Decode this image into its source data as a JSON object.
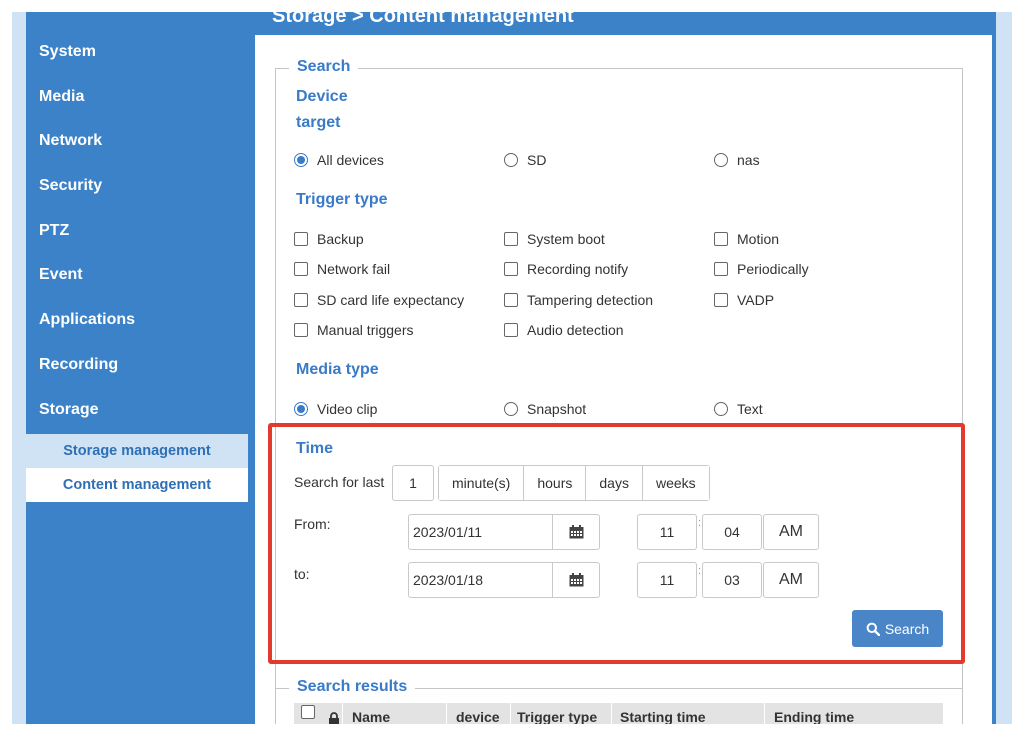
{
  "breadcrumb": "Storage  > Content management",
  "sidebar": {
    "items": [
      {
        "label": "System"
      },
      {
        "label": "Media"
      },
      {
        "label": "Network"
      },
      {
        "label": "Security"
      },
      {
        "label": "PTZ"
      },
      {
        "label": "Event"
      },
      {
        "label": "Applications"
      },
      {
        "label": "Recording"
      },
      {
        "label": "Storage"
      }
    ],
    "subitems": [
      {
        "label": "Storage management",
        "active": false
      },
      {
        "label": "Content management",
        "active": true
      }
    ]
  },
  "search": {
    "legend": "Search",
    "device_target": {
      "title_line1": "Device",
      "title_line2": "target",
      "options": [
        "All devices",
        "SD",
        "nas"
      ],
      "selected": "All devices"
    },
    "trigger_type": {
      "title": "Trigger type",
      "options": [
        "Backup",
        "System boot",
        "Motion",
        "Network fail",
        "Recording notify",
        "Periodically",
        "SD card life expectancy",
        "Tampering detection",
        "VADP",
        "Manual triggers",
        "Audio detection"
      ]
    },
    "media_type": {
      "title": "Media type",
      "options": [
        "Video clip",
        "Snapshot",
        "Text"
      ],
      "selected": "Video clip"
    }
  },
  "time": {
    "title": "Time",
    "search_for_last_label": "Search for last",
    "last_value": "1",
    "units": [
      "minute(s)",
      "hours",
      "days",
      "weeks"
    ],
    "from_label": "From:",
    "from_date": "2023/01/11",
    "from_hour": "11",
    "from_minute": "04",
    "from_ampm": "AM",
    "to_label": "to:",
    "to_date": "2023/01/18",
    "to_hour": "11",
    "to_minute": "03",
    "to_ampm": "AM",
    "search_button": "Search"
  },
  "results": {
    "legend": "Search results",
    "columns": [
      "Name",
      "device",
      "Trigger type",
      "Starting time",
      "Ending time"
    ]
  },
  "colors": {
    "accent": "#3a7bc8",
    "sidebar_bg": "#3b82c9",
    "highlight": "#e23a2e"
  }
}
